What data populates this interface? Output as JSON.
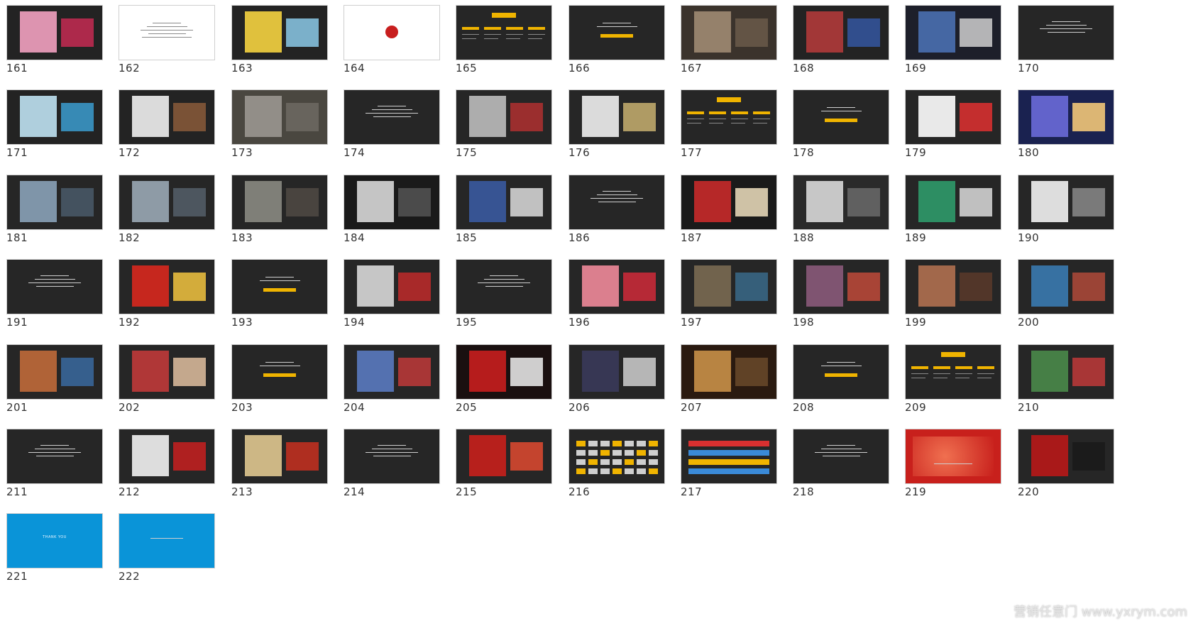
{
  "slides": [
    {
      "number": "161",
      "style": "photo",
      "colors": [
        "#232323",
        "#f2a1c0",
        "#c62a52"
      ]
    },
    {
      "number": "162",
      "style": "white"
    },
    {
      "number": "163",
      "style": "photo",
      "colors": [
        "#232323",
        "#f5d340",
        "#8bc9e8"
      ]
    },
    {
      "number": "164",
      "style": "white",
      "icon": "red-seal-icon"
    },
    {
      "number": "165",
      "style": "list"
    },
    {
      "number": "166",
      "style": "title"
    },
    {
      "number": "167",
      "style": "photo",
      "colors": [
        "#3b332c",
        "#a08a72",
        "#6b5b4a"
      ]
    },
    {
      "number": "168",
      "style": "photo",
      "colors": [
        "#232323",
        "#b03a3a",
        "#3456a0"
      ]
    },
    {
      "number": "169",
      "style": "photo",
      "colors": [
        "#1d1f2a",
        "#4a6fb0",
        "#cfcfcf"
      ]
    },
    {
      "number": "170",
      "style": "text"
    },
    {
      "number": "171",
      "style": "photo",
      "colors": [
        "#232323",
        "#bfe2f2",
        "#3b9ccf"
      ]
    },
    {
      "number": "172",
      "style": "photo",
      "colors": [
        "#232323",
        "#efefef",
        "#8a5a3a"
      ]
    },
    {
      "number": "173",
      "style": "photo",
      "colors": [
        "#4a4740",
        "#9a9690",
        "#6d6a63"
      ]
    },
    {
      "number": "174",
      "style": "text"
    },
    {
      "number": "175",
      "style": "photo",
      "colors": [
        "#262626",
        "#bdbdbd",
        "#b03030"
      ]
    },
    {
      "number": "176",
      "style": "photo",
      "colors": [
        "#262626",
        "#f0f0f0",
        "#c8b070"
      ]
    },
    {
      "number": "177",
      "style": "list"
    },
    {
      "number": "178",
      "style": "title"
    },
    {
      "number": "179",
      "style": "photo",
      "colors": [
        "#262626",
        "#ffffff",
        "#e03030"
      ]
    },
    {
      "number": "180",
      "style": "photo",
      "colors": [
        "#1a2250",
        "#6a6ad8",
        "#ffd07a"
      ]
    },
    {
      "number": "181",
      "style": "photo",
      "colors": [
        "#262626",
        "#8aa2b8",
        "#4a5a6a"
      ]
    },
    {
      "number": "182",
      "style": "photo",
      "colors": [
        "#262626",
        "#9aa8b5",
        "#555f6a"
      ]
    },
    {
      "number": "183",
      "style": "photo",
      "colors": [
        "#262626",
        "#8a8a82",
        "#504a44"
      ]
    },
    {
      "number": "184",
      "style": "photo",
      "colors": [
        "#1a1a1a",
        "#d8d8d8",
        "#555555"
      ]
    },
    {
      "number": "185",
      "style": "photo",
      "colors": [
        "#262626",
        "#3a5aa0",
        "#dddddd"
      ]
    },
    {
      "number": "186",
      "style": "text"
    },
    {
      "number": "187",
      "style": "photo",
      "colors": [
        "#1a1a1a",
        "#c82a2a",
        "#f0e0c0"
      ]
    },
    {
      "number": "188",
      "style": "photo",
      "colors": [
        "#2a2a2a",
        "#d8d8d8",
        "#6a6a6a"
      ]
    },
    {
      "number": "189",
      "style": "photo",
      "colors": [
        "#262626",
        "#2f9a6a",
        "#dcdcdc"
      ]
    },
    {
      "number": "190",
      "style": "photo",
      "colors": [
        "#262626",
        "#f2f2f2",
        "#8a8a8a"
      ]
    },
    {
      "number": "191",
      "style": "text"
    },
    {
      "number": "192",
      "style": "photo",
      "colors": [
        "#262626",
        "#d8281e",
        "#f2c440"
      ]
    },
    {
      "number": "193",
      "style": "title"
    },
    {
      "number": "194",
      "style": "photo",
      "colors": [
        "#262626",
        "#d8d8d8",
        "#c02a2a"
      ]
    },
    {
      "number": "195",
      "style": "text"
    },
    {
      "number": "196",
      "style": "photo",
      "colors": [
        "#262626",
        "#f08a9a",
        "#d02a3a"
      ]
    },
    {
      "number": "197",
      "style": "photo",
      "colors": [
        "#262626",
        "#7a6a52",
        "#3a6a8a"
      ]
    },
    {
      "number": "198",
      "style": "photo",
      "colors": [
        "#262626",
        "#8a5a7a",
        "#c04a3a"
      ]
    },
    {
      "number": "199",
      "style": "photo",
      "colors": [
        "#262626",
        "#b07050",
        "#5a3a2a"
      ]
    },
    {
      "number": "200",
      "style": "photo",
      "colors": [
        "#262626",
        "#3a7ab0",
        "#b04a3a"
      ]
    },
    {
      "number": "201",
      "style": "photo",
      "colors": [
        "#262626",
        "#c06a3a",
        "#3a6aa0"
      ]
    },
    {
      "number": "202",
      "style": "photo",
      "colors": [
        "#262626",
        "#c03a3a",
        "#e0c0a0"
      ]
    },
    {
      "number": "203",
      "style": "title"
    },
    {
      "number": "204",
      "style": "photo",
      "colors": [
        "#262626",
        "#5a7ac0",
        "#c03a3a"
      ]
    },
    {
      "number": "205",
      "style": "photo",
      "colors": [
        "#1a1010",
        "#c81e1e",
        "#f0f0f0"
      ]
    },
    {
      "number": "206",
      "style": "photo",
      "colors": [
        "#262626",
        "#3a3a5a",
        "#d0d0d0"
      ]
    },
    {
      "number": "207",
      "style": "photo",
      "colors": [
        "#2a1a10",
        "#c89048",
        "#6a4a2a"
      ]
    },
    {
      "number": "208",
      "style": "title"
    },
    {
      "number": "209",
      "style": "list"
    },
    {
      "number": "210",
      "style": "photo",
      "colors": [
        "#262626",
        "#4a8a4a",
        "#c03a3a"
      ]
    },
    {
      "number": "211",
      "style": "text"
    },
    {
      "number": "212",
      "style": "photo",
      "colors": [
        "#262626",
        "#f2f2f2",
        "#c82020"
      ]
    },
    {
      "number": "213",
      "style": "photo",
      "colors": [
        "#262626",
        "#e0c890",
        "#c83020"
      ]
    },
    {
      "number": "214",
      "style": "text"
    },
    {
      "number": "215",
      "style": "photo",
      "colors": [
        "#262626",
        "#c8201c",
        "#e04a30"
      ]
    },
    {
      "number": "216",
      "style": "grid"
    },
    {
      "number": "217",
      "style": "grid2"
    },
    {
      "number": "218",
      "style": "text"
    },
    {
      "number": "219",
      "style": "red"
    },
    {
      "number": "220",
      "style": "photo",
      "colors": [
        "#262626",
        "#b81818",
        "#1a1a1a"
      ]
    },
    {
      "number": "221",
      "style": "blue",
      "text": "THANK YOU"
    },
    {
      "number": "222",
      "style": "blue"
    }
  ],
  "watermark": "营销任意门 www.yxrym.com"
}
